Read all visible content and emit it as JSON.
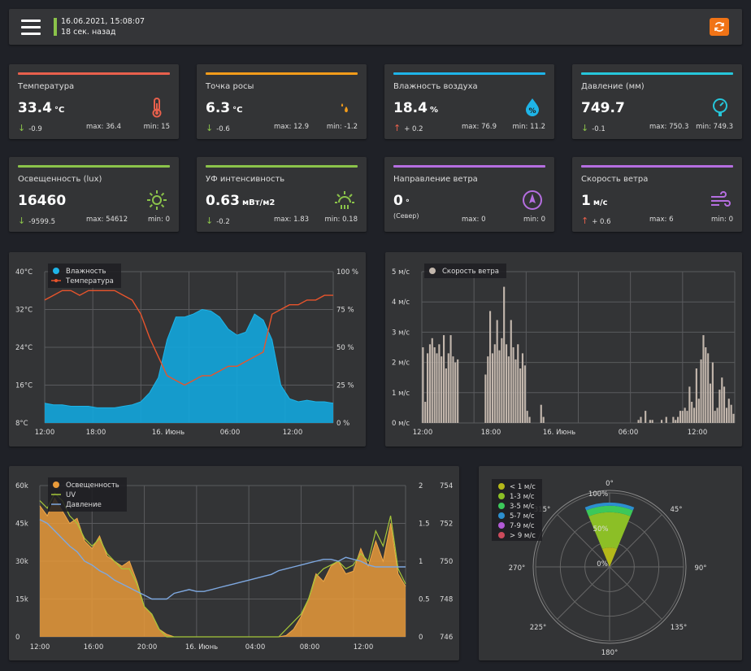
{
  "header": {
    "datetime": "16.06.2021, 15:08:07",
    "ago": "18 сек. назад"
  },
  "colors": {
    "green": "#8bc34a",
    "red": "#e8604c",
    "orange": "#f39c1a",
    "blue": "#1eb4e8",
    "cyan": "#26c6da",
    "purple": "#b56ee0"
  },
  "cards": [
    {
      "title": "Температура",
      "value": "33.4",
      "unit": "°C",
      "trend": "-0.9",
      "dir": "down",
      "max": "max: 36.4",
      "min": "min: 15"
    },
    {
      "title": "Точка росы",
      "value": "6.3",
      "unit": "°C",
      "trend": "-0.6",
      "dir": "down",
      "max": "max: 12.9",
      "min": "min: -1.2"
    },
    {
      "title": "Влажность воздуха",
      "value": "18.4",
      "unit": "%",
      "trend": "+ 0.2",
      "dir": "up",
      "max": "max: 76.9",
      "min": "min: 11.2"
    },
    {
      "title": "Давление (мм)",
      "value": "749.7",
      "unit": "",
      "trend": "-0.1",
      "dir": "down",
      "max": "max: 750.3",
      "min": "min: 749.3"
    },
    {
      "title": "Освещенность (lux)",
      "value": "16460",
      "unit": "",
      "trend": "-9599.5",
      "dir": "down",
      "max": "max: 54612",
      "min": "min: 0"
    },
    {
      "title": "УФ интенсивность",
      "value": "0.63",
      "unit": "мВт/м2",
      "trend": "-0.2",
      "dir": "down",
      "max": "max: 1.83",
      "min": "min: 0.18"
    },
    {
      "title": "Направление ветра",
      "value": "0",
      "unit": "°",
      "trend": "(Север)",
      "dir": "none",
      "max": "max: 0",
      "min": "min: 0"
    },
    {
      "title": "Скорость ветра",
      "value": "1",
      "unit": "м/с",
      "trend": "+ 0.6",
      "dir": "up",
      "max": "max: 6",
      "min": "min: 0"
    }
  ],
  "chart_data": [
    {
      "type": "area",
      "legend": [
        "Влажность",
        "Температура"
      ],
      "x_ticks": [
        "12:00",
        "18:00",
        "16. Июнь",
        "06:00",
        "12:00"
      ],
      "y_left_ticks": [
        "40°C",
        "32°C",
        "24°C",
        "16°C",
        "8°C"
      ],
      "y_right_ticks": [
        "100 %",
        "75 %",
        "50 %",
        "25 %",
        "0 %"
      ],
      "ylim_left": [
        8,
        40
      ],
      "ylim_right": [
        0,
        100
      ],
      "series": [
        {
          "name": "Влажность",
          "axis": "right",
          "values": [
            13,
            12,
            12,
            11,
            11,
            11,
            10,
            10,
            10,
            11,
            12,
            14,
            20,
            30,
            55,
            70,
            70,
            72,
            75,
            74,
            70,
            62,
            58,
            60,
            72,
            68,
            55,
            25,
            16,
            14,
            15,
            14,
            14,
            13
          ]
        },
        {
          "name": "Температура",
          "axis": "left",
          "values": [
            34,
            35,
            36,
            36,
            35,
            36,
            36,
            36,
            36,
            35,
            34,
            31,
            26,
            22,
            18,
            17,
            16,
            17,
            18,
            18,
            19,
            20,
            20,
            21,
            22,
            23,
            31,
            32,
            33,
            33,
            34,
            34,
            35,
            35
          ]
        }
      ]
    },
    {
      "type": "bar",
      "legend": [
        "Скорость ветра"
      ],
      "x_ticks": [
        "12:00",
        "18:00",
        "16. Июнь",
        "06:00",
        "12:00"
      ],
      "y_ticks": [
        "5 м/с",
        "4 м/с",
        "3 м/с",
        "2 м/с",
        "1 м/с",
        "0 м/с"
      ],
      "ylim": [
        0,
        5
      ],
      "values": [
        2.5,
        0.7,
        2.3,
        2.6,
        2.8,
        2.5,
        2.3,
        2.6,
        2.2,
        2.9,
        1.8,
        2.3,
        2.9,
        2.2,
        2,
        2.1,
        0,
        0,
        0,
        0,
        0,
        0,
        0,
        0,
        0,
        0,
        0,
        1.6,
        2.2,
        3.7,
        2.3,
        2.6,
        3.4,
        2.4,
        2.8,
        4.5,
        2.6,
        2.2,
        3.4,
        2.5,
        2.1,
        2.6,
        1.8,
        2.3,
        1.9,
        0.4,
        0.2,
        0,
        0,
        0,
        0,
        0.6,
        0.2,
        0,
        0,
        0,
        0,
        0,
        0,
        0,
        0,
        0,
        0,
        0,
        0,
        0,
        0,
        0,
        0,
        0,
        0,
        0,
        0,
        0,
        0,
        0,
        0,
        0,
        0,
        0,
        0,
        0,
        0,
        0,
        0,
        0,
        0,
        0,
        0,
        0,
        0,
        0,
        0,
        0.1,
        0.2,
        0,
        0.4,
        0,
        0.1,
        0.1,
        0,
        0,
        0,
        0.1,
        0,
        0.2,
        0,
        0,
        0.2,
        0.1,
        0.2,
        0.4,
        0.4,
        0.5,
        0.4,
        1.2,
        0.7,
        0.5,
        1.8,
        0.8,
        2.1,
        2.9,
        2.5,
        2.3,
        1.3,
        2,
        0.4,
        0.5,
        1.1,
        1.5,
        1.2,
        0.5,
        0.8,
        0.6,
        0.3
      ]
    },
    {
      "type": "area",
      "legend": [
        "Освещенность",
        "UV",
        "Давление"
      ],
      "x_ticks": [
        "12:00",
        "16:00",
        "20:00",
        "16. Июнь",
        "04:00",
        "08:00",
        "12:00"
      ],
      "y_left_ticks": [
        "60k",
        "45k",
        "30k",
        "15k",
        "0"
      ],
      "y_uv_ticks": [
        "2",
        "1.5",
        "1",
        "0.5",
        "0"
      ],
      "y_press_ticks": [
        "754",
        "752",
        "750",
        "748",
        "746"
      ],
      "series": [
        {
          "name": "Освещенность",
          "axis": "left",
          "values": [
            52000,
            48000,
            55000,
            50000,
            45000,
            47000,
            38000,
            35000,
            40000,
            32000,
            30000,
            28000,
            30000,
            22000,
            12000,
            9000,
            3000,
            1000,
            0,
            0,
            0,
            0,
            0,
            0,
            0,
            0,
            0,
            0,
            0,
            0,
            0,
            0,
            0,
            500,
            3000,
            8000,
            15000,
            25000,
            22000,
            28000,
            30000,
            25000,
            26000,
            35000,
            28000,
            38000,
            30000,
            45000,
            25000,
            20000
          ]
        },
        {
          "name": "UV",
          "axis": "uv",
          "values": [
            1.8,
            1.7,
            1.9,
            1.8,
            1.6,
            1.5,
            1.3,
            1.2,
            1.3,
            1.1,
            1,
            0.9,
            0.9,
            0.7,
            0.4,
            0.3,
            0.1,
            0,
            0,
            0,
            0,
            0,
            0,
            0,
            0,
            0,
            0,
            0,
            0,
            0,
            0,
            0,
            0,
            0.1,
            0.2,
            0.3,
            0.5,
            0.8,
            0.9,
            0.95,
            1,
            0.9,
            0.95,
            1.1,
            1,
            1.4,
            1.2,
            1.6,
            0.9,
            0.7
          ]
        },
        {
          "name": "Давление",
          "axis": "press",
          "values": [
            752.2,
            752,
            751.6,
            751.2,
            750.8,
            750.5,
            750,
            749.8,
            749.5,
            749.3,
            749,
            748.8,
            748.6,
            748.4,
            748.2,
            748,
            748,
            748,
            748.3,
            748.4,
            748.5,
            748.4,
            748.4,
            748.5,
            748.6,
            748.7,
            748.8,
            748.9,
            749,
            749.1,
            749.2,
            749.3,
            749.5,
            749.6,
            749.7,
            749.8,
            749.9,
            750,
            750.1,
            750.1,
            750,
            750.2,
            750.1,
            750,
            749.8,
            749.7,
            749.7,
            749.7,
            749.7,
            749.7
          ]
        }
      ]
    },
    {
      "type": "polar",
      "legend": [
        "< 1 м/с",
        "1-3 м/с",
        "3-5 м/с",
        "5-7 м/с",
        "7-9 м/с",
        "> 9 м/с"
      ],
      "legend_colors": [
        "#b5b81a",
        "#8cbf26",
        "#3cc85a",
        "#2c8fcf",
        "#b25ad6",
        "#cc4b5c"
      ],
      "angle_ticks": [
        "0°",
        "45°",
        "90°",
        "135°",
        "180°",
        "225°",
        "270°",
        "315°"
      ],
      "radial_ticks": [
        "100%",
        "50%",
        "0%"
      ],
      "sectors": [
        {
          "direction": "0°",
          "bands": [
            30,
            55,
            10,
            5
          ]
        }
      ]
    }
  ]
}
